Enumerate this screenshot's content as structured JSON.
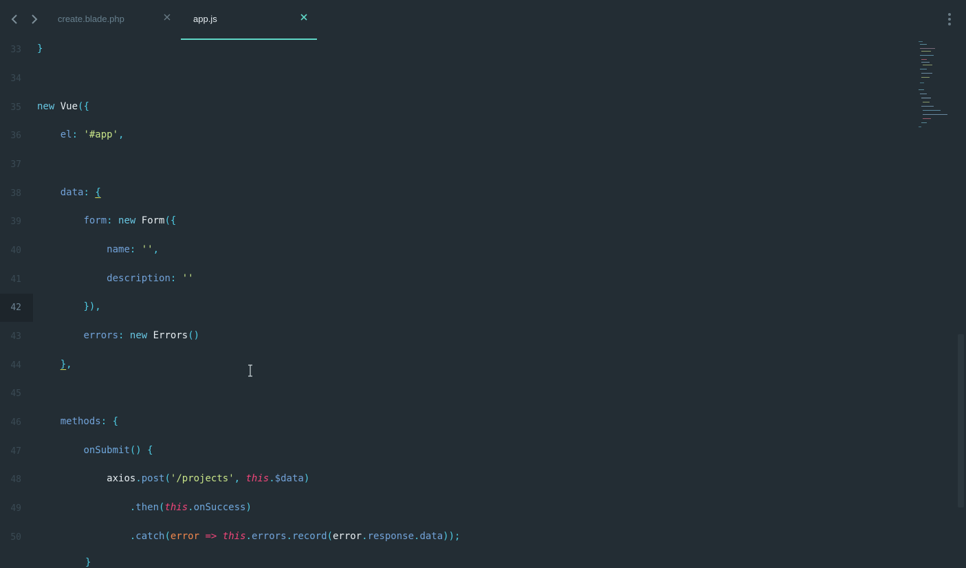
{
  "tabs": [
    {
      "label": "create.blade.php",
      "active": false
    },
    {
      "label": "app.js",
      "active": true
    }
  ],
  "nav": {
    "back_icon": "chevron-left-icon",
    "forward_icon": "chevron-right-icon",
    "menu_icon": "kebab-menu-icon",
    "close_icon": "close-icon"
  },
  "editor": {
    "current_line": 42,
    "lines": [
      {
        "n": "33",
        "code": "}"
      },
      {
        "n": "34",
        "code": ""
      },
      {
        "n": "35",
        "code": "new Vue({"
      },
      {
        "n": "36",
        "code": "    el: '#app',"
      },
      {
        "n": "37",
        "code": ""
      },
      {
        "n": "38",
        "code": "    data: {"
      },
      {
        "n": "39",
        "code": "        form: new Form({"
      },
      {
        "n": "40",
        "code": "            name: '',"
      },
      {
        "n": "41",
        "code": "            description: ''"
      },
      {
        "n": "42",
        "code": "        }),"
      },
      {
        "n": "43",
        "code": "        errors: new Errors()"
      },
      {
        "n": "44",
        "code": "    },"
      },
      {
        "n": "45",
        "code": ""
      },
      {
        "n": "46",
        "code": "    methods: {"
      },
      {
        "n": "47",
        "code": "        onSubmit() {"
      },
      {
        "n": "48",
        "code": "            axios.post('/projects', this.$data)"
      },
      {
        "n": "49",
        "code": "                .then(this.onSuccess)"
      },
      {
        "n": "50",
        "code": "                .catch(error => this.errors.record(error.response.data));"
      }
    ]
  },
  "colors": {
    "background": "#232d34",
    "keyword": "#68c6e2",
    "string": "#c8e488",
    "this": "#f0467a",
    "tab_accent": "#5fd7c7"
  }
}
